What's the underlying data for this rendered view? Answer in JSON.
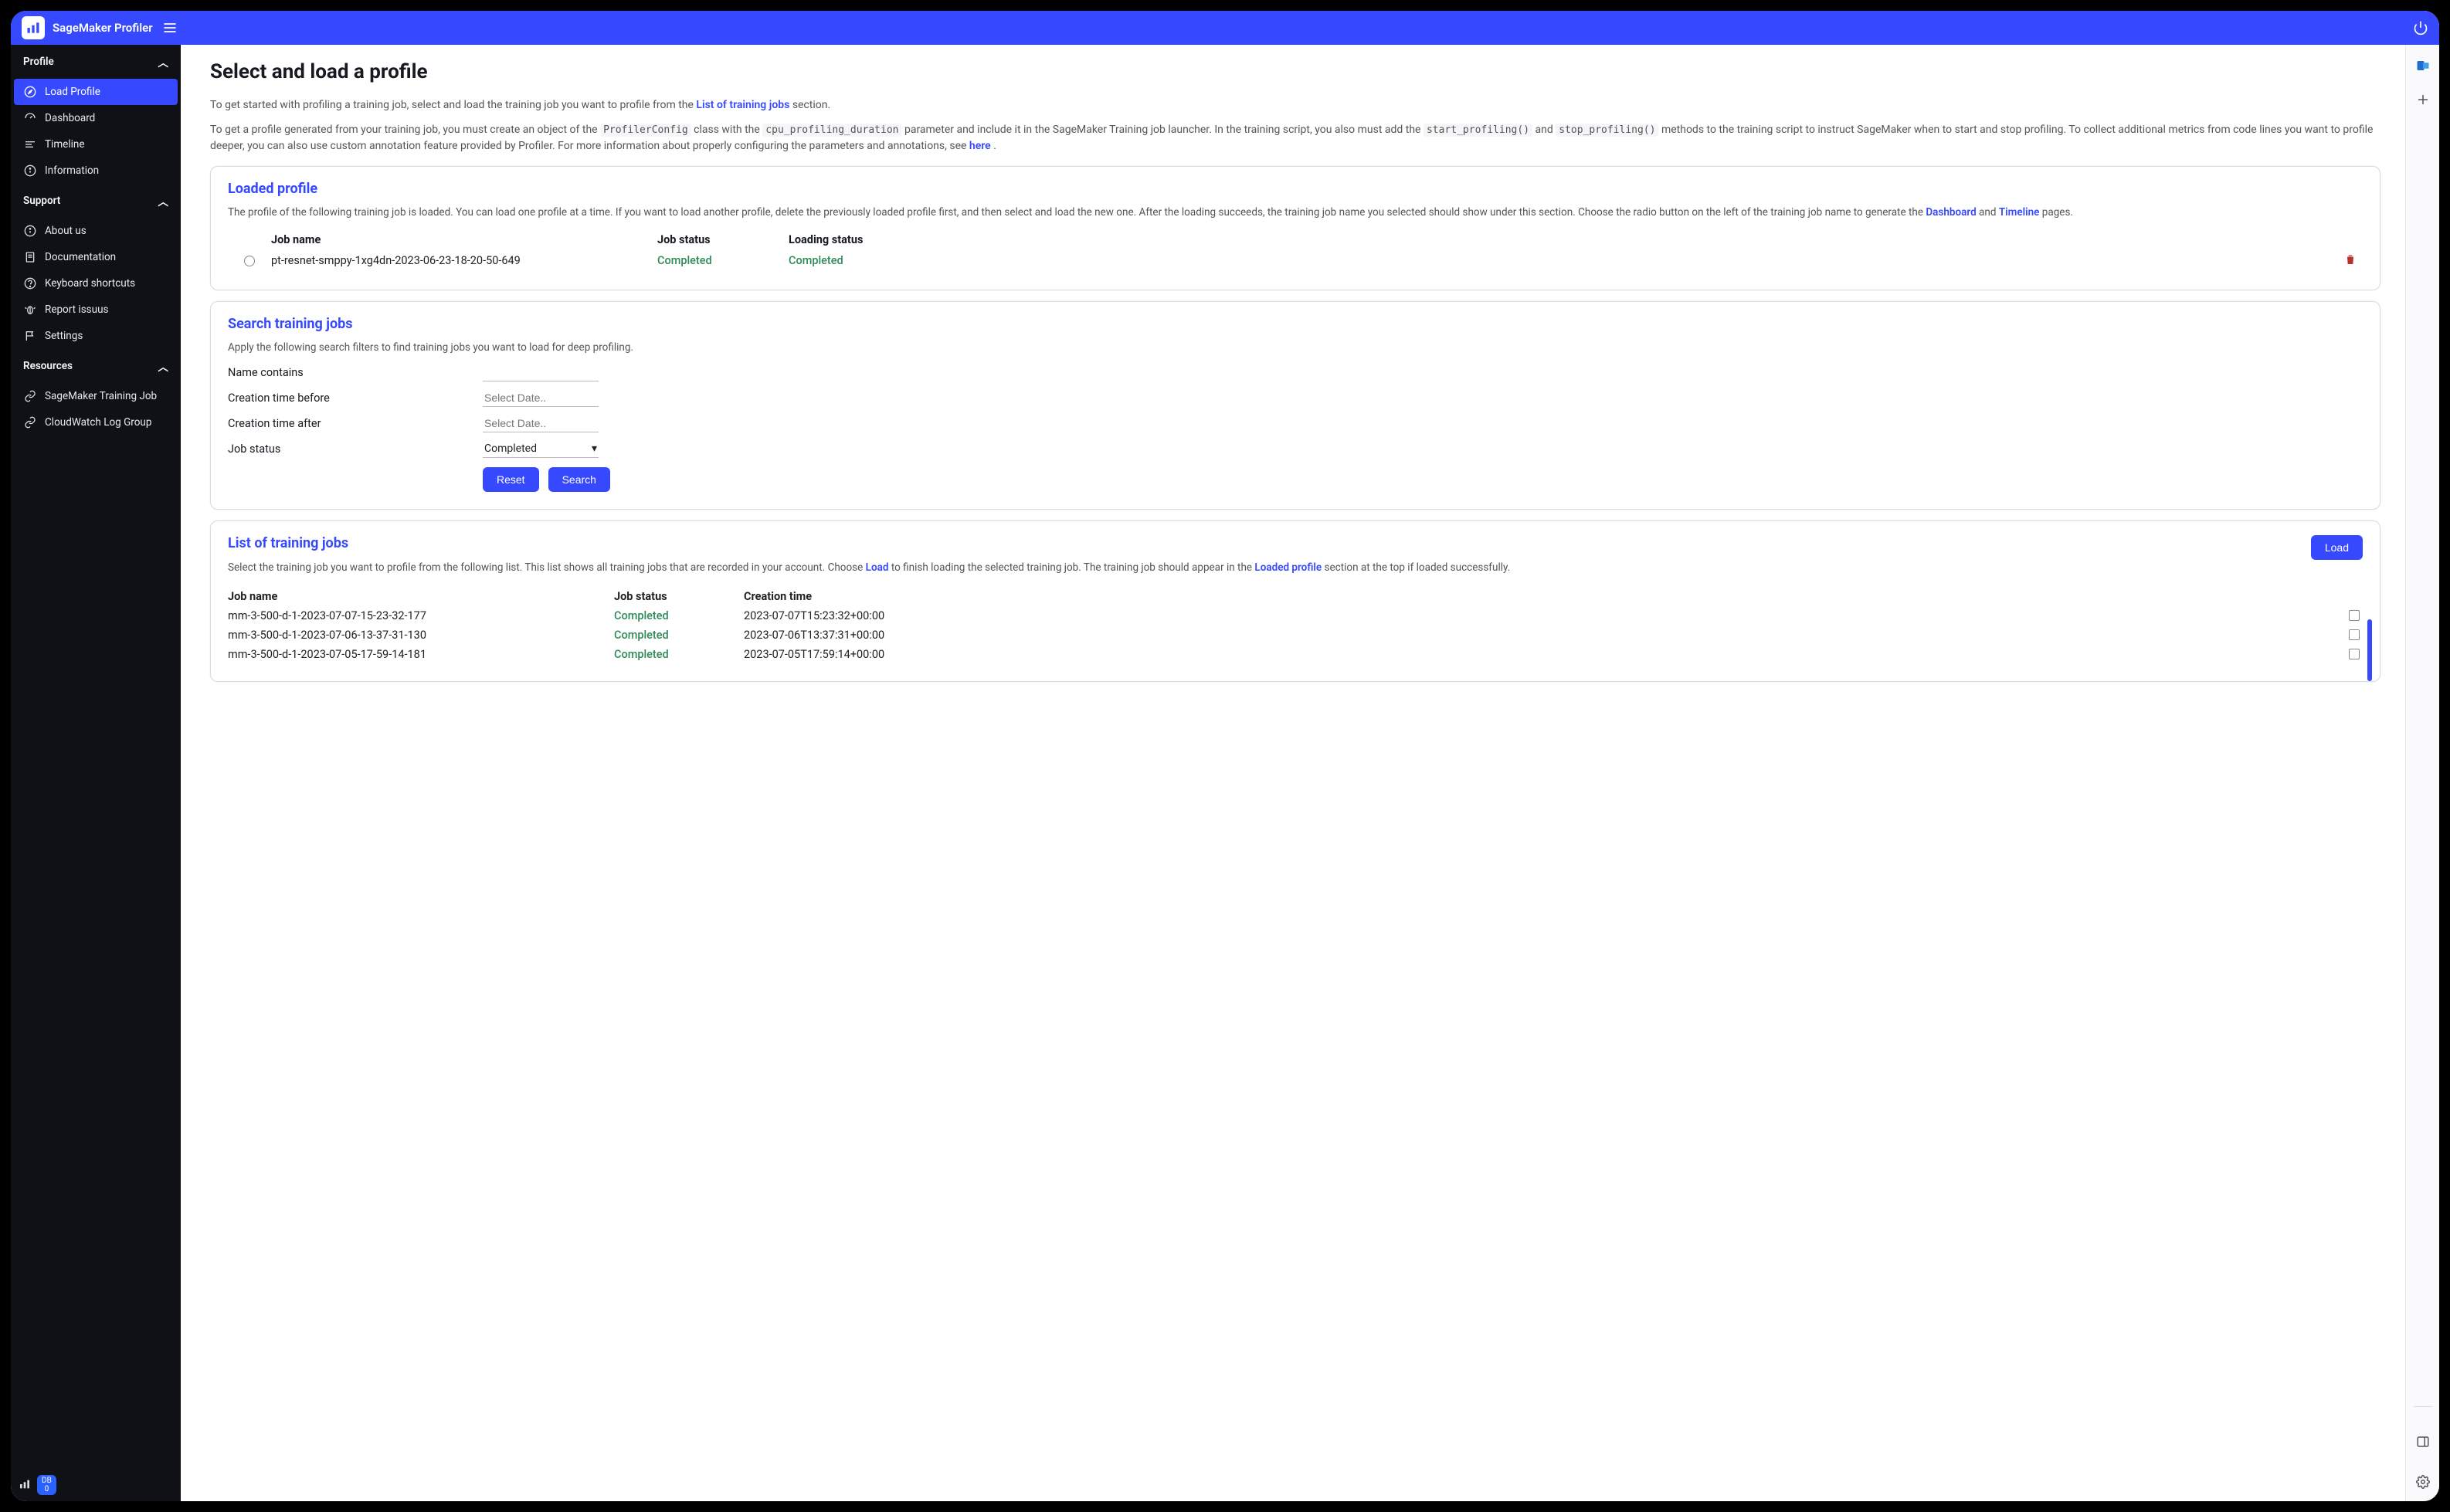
{
  "app": {
    "title": "SageMaker Profiler"
  },
  "sidebar": {
    "sections": [
      {
        "title": "Profile",
        "items": [
          {
            "label": "Load Profile",
            "icon": "compass-icon",
            "active": true
          },
          {
            "label": "Dashboard",
            "icon": "speedometer-icon"
          },
          {
            "label": "Timeline",
            "icon": "timeline-icon"
          },
          {
            "label": "Information",
            "icon": "info-icon"
          }
        ]
      },
      {
        "title": "Support",
        "items": [
          {
            "label": "About us",
            "icon": "info-icon"
          },
          {
            "label": "Documentation",
            "icon": "doc-icon"
          },
          {
            "label": "Keyboard shortcuts",
            "icon": "help-icon"
          },
          {
            "label": "Report issuus",
            "icon": "bug-icon"
          },
          {
            "label": "Settings",
            "icon": "flag-icon"
          }
        ]
      },
      {
        "title": "Resources",
        "items": [
          {
            "label": "SageMaker Training Job",
            "icon": "link-icon"
          },
          {
            "label": "CloudWatch Log Group",
            "icon": "link-icon"
          }
        ]
      }
    ],
    "footer": {
      "badge_top": "DB",
      "badge_bottom": "0"
    }
  },
  "page": {
    "title": "Select and load a profile",
    "intro_prefix": "To get started with profiling a training job, select and load the training job you want to profile from the ",
    "intro_link": "List of training jobs",
    "intro_suffix": " section.",
    "para2_a": "To get a profile generated from your training job, you must create an object of the ",
    "code1": "ProfilerConfig",
    "para2_b": " class with the ",
    "code2": "cpu_profiling_duration",
    "para2_c": " parameter and include it in the SageMaker Training job launcher. In the training script, you also must add the ",
    "code3": "start_profiling()",
    "para2_d": " and ",
    "code4": "stop_profiling()",
    "para2_e": " methods to the training script to instruct SageMaker when to start and stop profiling. To collect additional metrics from code lines you want to profile deeper, you can also use custom annotation feature provided by Profiler. For more information about properly configuring the parameters and annotations, see ",
    "here_link": "here",
    "para2_f": "."
  },
  "loaded": {
    "title": "Loaded profile",
    "desc_a": "The profile of the following training job is loaded. You can load one profile at a time. If you want to load another profile, delete the previously loaded profile first, and then select and load the new one. After the loading succeeds, the training job name you selected should show under this section. Choose the radio button on the left of the training job name to generate the ",
    "link1": "Dashboard",
    "desc_b": " and ",
    "link2": "Timeline",
    "desc_c": " pages.",
    "head": {
      "name": "Job name",
      "jstatus": "Job status",
      "lstatus": "Loading status"
    },
    "row": {
      "name": "pt-resnet-smppy-1xg4dn-2023-06-23-18-20-50-649",
      "jstatus": "Completed",
      "lstatus": "Completed"
    }
  },
  "search": {
    "title": "Search training jobs",
    "desc": "Apply the following search filters to find training jobs you want to load for deep profiling.",
    "labels": {
      "name": "Name contains",
      "before": "Creation time before",
      "after": "Creation time after",
      "status": "Job status"
    },
    "placeholders": {
      "before": "Select Date..",
      "after": "Select Date.."
    },
    "status_value": "Completed",
    "reset": "Reset",
    "search_btn": "Search"
  },
  "list": {
    "title": "List of training jobs",
    "load_btn": "Load",
    "desc_a": "Select the training job you want to profile from the following list. This list shows all training jobs that are recorded in your account. Choose ",
    "link1": "Load",
    "desc_b": " to finish loading the selected training job. The training job should appear in the ",
    "link2": "Loaded profile",
    "desc_c": " section at the top if loaded successfully.",
    "head": {
      "name": "Job name",
      "status": "Job status",
      "created": "Creation time"
    },
    "rows": [
      {
        "name": "mm-3-500-d-1-2023-07-07-15-23-32-177",
        "status": "Completed",
        "created": "2023-07-07T15:23:32+00:00"
      },
      {
        "name": "mm-3-500-d-1-2023-07-06-13-37-31-130",
        "status": "Completed",
        "created": "2023-07-06T13:37:31+00:00"
      },
      {
        "name": "mm-3-500-d-1-2023-07-05-17-59-14-181",
        "status": "Completed",
        "created": "2023-07-05T17:59:14+00:00"
      }
    ]
  }
}
